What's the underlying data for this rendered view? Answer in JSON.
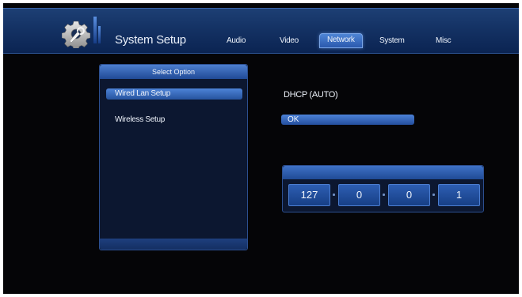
{
  "header": {
    "app_icon": "gear-wrench-icon",
    "title": "System Setup",
    "tabs": [
      {
        "label": "Audio",
        "active": false
      },
      {
        "label": "Video",
        "active": false
      },
      {
        "label": "Network",
        "active": true
      },
      {
        "label": "System",
        "active": false
      },
      {
        "label": "Misc",
        "active": false
      }
    ]
  },
  "option_panel": {
    "title": "Select Option",
    "items": [
      {
        "label": "Wired Lan Setup",
        "selected": true
      },
      {
        "label": "Wireless Setup",
        "selected": false
      }
    ]
  },
  "detail": {
    "mode_label": "DHCP (AUTO)",
    "confirm_label": "OK",
    "ip_octets": [
      "127",
      "0",
      "0",
      "1"
    ]
  },
  "colors": {
    "background": "#050507",
    "header_blue": "#143264",
    "highlight_blue": "#3a6dc2",
    "panel_fill": "#0c1730",
    "text": "#eef3fb"
  }
}
